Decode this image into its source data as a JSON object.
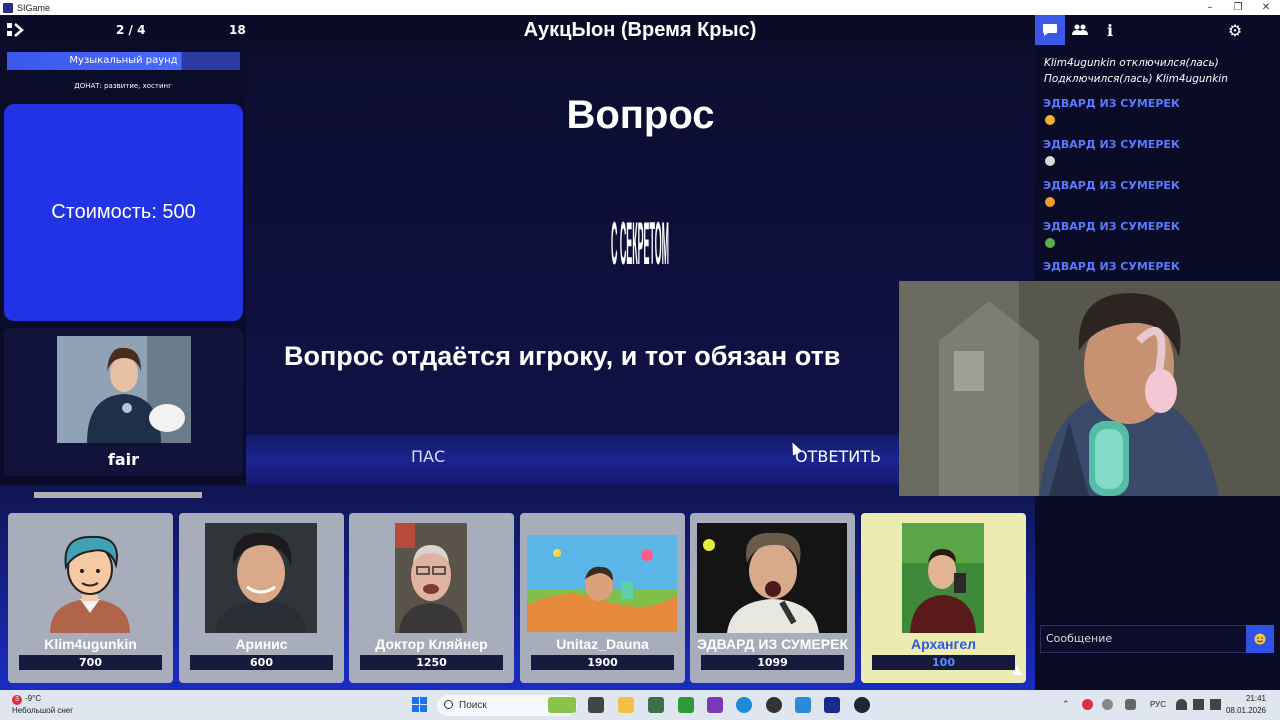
{
  "window": {
    "title": "SIGame"
  },
  "header": {
    "round_counter": "2 / 4",
    "players_count": "18",
    "game_title": "АукцЫон (Время Крыс)"
  },
  "left": {
    "round_name": "Музыкальный раунд",
    "donate": "ДОНАТ: развитие, хостинг",
    "cost": "Стоимость: 500",
    "host_name": "fair"
  },
  "main": {
    "heading": "Вопрос",
    "logo_text": "С СЕКРЕТОМ",
    "question_text": "Вопрос отдаётся игроку, и тот обязан отв",
    "pass_label": "ПАС",
    "answer_label": "ОТВЕТИТЬ"
  },
  "players": [
    {
      "name": "Klim4ugunkin",
      "score": "700",
      "avatar": "cartoon-avatar"
    },
    {
      "name": "Аринис",
      "score": "600",
      "avatar": "photo"
    },
    {
      "name": "Доктор Кляйнер",
      "score": "1250",
      "avatar": "photo"
    },
    {
      "name": "Unitaz_Dauna",
      "score": "1900",
      "avatar": "photo"
    },
    {
      "name": "ЭДВАРД ИЗ СУМЕРЕК",
      "score": "1099",
      "avatar": "photo"
    },
    {
      "name": "Архангел",
      "score": "100",
      "avatar": "photo",
      "highlighted": true
    }
  ],
  "chat": {
    "system_messages": [
      "Klim4ugunkin отключился(лась)",
      "Подключился(лась) Klim4ugunkin"
    ],
    "messages": [
      {
        "author": "ЭДВАРД ИЗ СУМЕРЕК",
        "emoji_color": "#f2b233"
      },
      {
        "author": "ЭДВАРД ИЗ СУМЕРЕК",
        "emoji_color": "#d8d8d8"
      },
      {
        "author": "ЭДВАРД ИЗ СУМЕРЕК",
        "emoji_color": "#f29a33"
      },
      {
        "author": "ЭДВАРД ИЗ СУМЕРЕК",
        "emoji_color": "#5ab04a"
      },
      {
        "author": "ЭДВАРД ИЗ СУМЕРЕК",
        "emoji_color": "#f2b233"
      }
    ],
    "input_placeholder": "Сообщение"
  },
  "taskbar": {
    "weather_badge": "3",
    "temperature": "-9°C",
    "weather_desc": "Небольшой снег",
    "search_label": "Поиск",
    "language": "РУС",
    "time": "21:41",
    "date": "08.01.2026"
  },
  "colors": {
    "accent": "#3a57e8",
    "cost_card": "#2233e6",
    "chat_author": "#5a7bff",
    "background": "#0b0c2a"
  }
}
